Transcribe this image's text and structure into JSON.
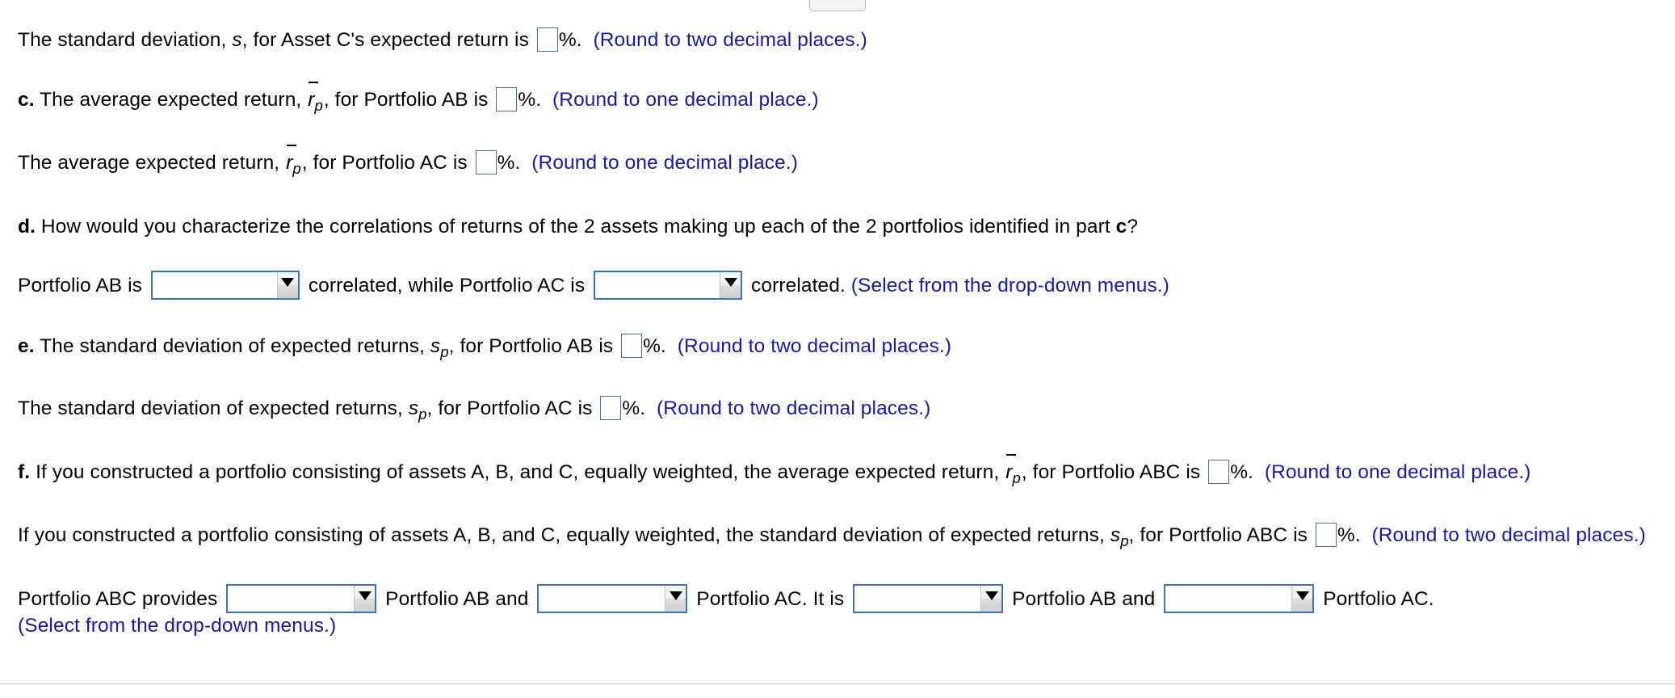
{
  "top_control": {
    "icon": "pill-handle"
  },
  "colors": {
    "hint_blue": "#1a1a9c",
    "input_border_blue": "#4272b0",
    "text_black": "#000000",
    "page_background": "#ffffff"
  },
  "lines": {
    "line_a": {
      "text_1": "The standard deviation, ",
      "var_s": "s",
      "text_2": ", for Asset C's expected return is ",
      "pct": "%.",
      "hint": "(Round to two decimal places.)"
    },
    "line_c1": {
      "part_label": "c.",
      "text_1": " The average expected return, ",
      "var_r": "r",
      "var_sub": "p",
      "text_2": ", for Portfolio AB is ",
      "pct": "%.",
      "hint": "(Round to one decimal place.)"
    },
    "line_c2": {
      "text_1": "The average expected return, ",
      "var_r": "r",
      "var_sub": "p",
      "text_2": ", for Portfolio AC is ",
      "pct": "%.",
      "hint": "(Round to one decimal place.)"
    },
    "line_d": {
      "part_label": "d.",
      "text_1": " How would you characterize the correlations of returns of the 2 assets making up each of the 2 portfolios identified in part ",
      "part_ref": "c",
      "text_2": "?"
    },
    "line_d_selects": {
      "text_1": "Portfolio AB is ",
      "text_2": " correlated, while Portfolio AC is ",
      "text_3": " correlated.  ",
      "hint": "(Select from the drop-down menus.)",
      "dropdown_ab_value": "",
      "dropdown_ac_value": ""
    },
    "line_e1": {
      "part_label": "e.",
      "text_1": " The standard deviation of expected returns, ",
      "var_s": "s",
      "var_sub": "p",
      "text_2": ", for Portfolio AB is ",
      "pct": "%.",
      "hint": "(Round to two decimal places.)"
    },
    "line_e2": {
      "text_1": "The standard deviation of expected returns, ",
      "var_s": "s",
      "var_sub": "p",
      "text_2": ", for Portfolio AC is ",
      "pct": "%.",
      "hint": "(Round to two decimal places.)"
    },
    "line_f1": {
      "part_label": "f.",
      "text_1": " If you constructed a portfolio consisting of assets A, B, and C, equally weighted, the average expected return, ",
      "var_r": "r",
      "var_sub": "p",
      "text_2": ", for Portfolio ABC is ",
      "pct": "%.",
      "hint": "(Round to one decimal place.)"
    },
    "line_f2": {
      "text_1": "If you constructed a portfolio consisting of assets A, B, and C, equally weighted, the standard deviation of expected returns, ",
      "var_s": "s",
      "var_sub": "p",
      "text_2": ", for Portfolio ABC is ",
      "pct": "%.",
      "hint": "(Round to two decimal places.)"
    },
    "line_f_selects": {
      "text_1": "Portfolio ABC provides ",
      "text_2": " Portfolio AB and ",
      "text_3": " Portfolio AC.  It is ",
      "text_4": " Portfolio AB and ",
      "text_5": " Portfolio AC.",
      "hint": "(Select from the drop-down menus.)",
      "dropdown_1_value": "",
      "dropdown_2_value": "",
      "dropdown_3_value": "",
      "dropdown_4_value": ""
    }
  },
  "icons": {
    "dropdown_arrow": "chevron-down-triangle-icon"
  }
}
